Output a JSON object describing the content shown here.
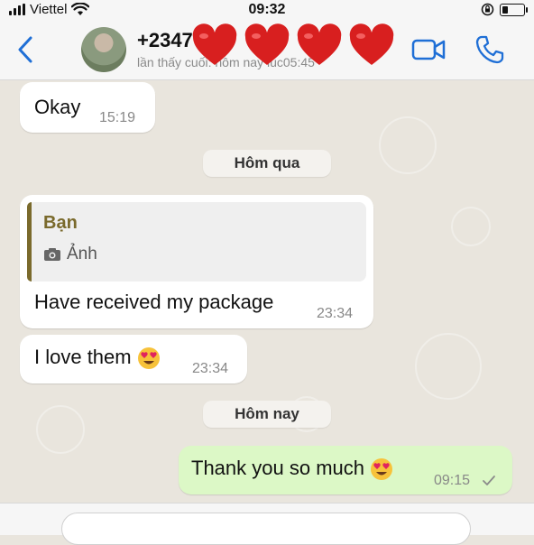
{
  "status_bar": {
    "carrier": "Viettel",
    "time": "09:32",
    "icons": [
      "signal-icon",
      "wifi-icon",
      "rotation-lock-icon",
      "battery-icon"
    ]
  },
  "header": {
    "contact_name": "+2347",
    "last_seen": "lần thấy cuối: hôm nay lúc05:45",
    "icons": [
      "back-chevron-icon",
      "video-call-icon",
      "voice-call-icon",
      "heart-icon"
    ],
    "accent_color": "#1f6fd6"
  },
  "messages": [
    {
      "direction": "incoming",
      "text": "Okay",
      "time": "15:19"
    },
    {
      "type": "date",
      "label": "Hôm qua"
    },
    {
      "direction": "incoming",
      "quote_author": "Bạn",
      "quote_text": "Ảnh",
      "text": "Have received my package",
      "time": "23:34"
    },
    {
      "direction": "incoming",
      "text": "I love them",
      "emoji": "heart-eyes-emoji",
      "time": "23:34"
    },
    {
      "type": "date",
      "label": "Hôm nay"
    },
    {
      "direction": "outgoing",
      "text": "Thank you so much",
      "emoji": "heart-eyes-emoji",
      "time": "09:15",
      "status": "sent-check-icon"
    }
  ],
  "colors": {
    "incoming_bubble": "#ffffff",
    "outgoing_bubble": "#dcf8c6",
    "chat_background": "#e9e5dd",
    "quote_accent": "#7a6a2c"
  }
}
